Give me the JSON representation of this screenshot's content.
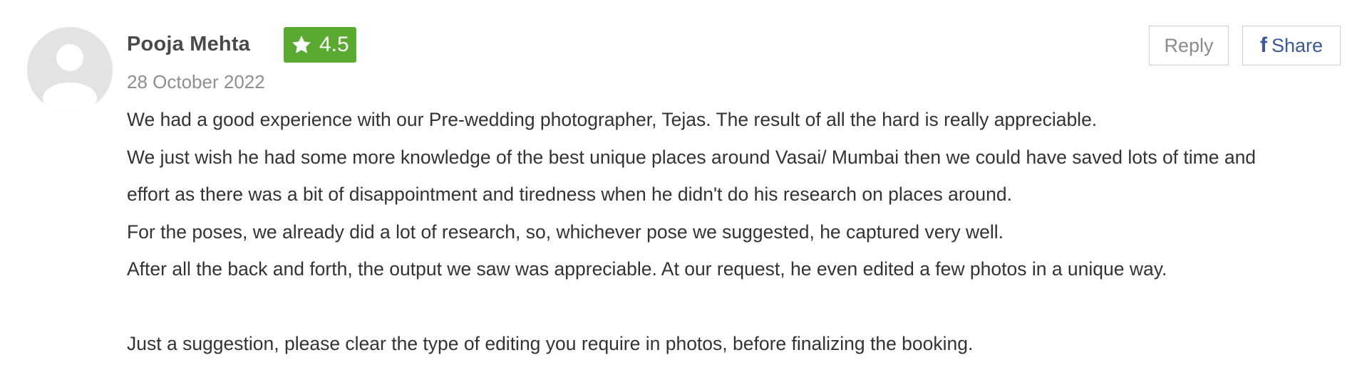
{
  "review": {
    "reviewer_name": "Pooja Mehta",
    "rating": "4.5",
    "date": "28 October 2022",
    "reply_label": "Reply",
    "share_icon": "f",
    "share_label": "Share",
    "paragraphs": [
      "We had a good experience with our Pre-wedding photographer, Tejas. The result of all the hard is really appreciable.",
      "We just wish he had some more knowledge of the best unique places around Vasai/ Mumbai then we could have saved lots of time and",
      "effort as there was a bit of disappointment and tiredness when he didn't do his research on places around.",
      "For the poses, we already did a lot of research, so, whichever pose we suggested, he captured very well.",
      "After all the back and forth, the output we saw was appreciable. At our request, he even edited a few photos in a unique way.",
      "",
      "Just a suggestion, please clear the type of editing you require in photos, before finalizing the booking."
    ]
  },
  "icons": {
    "avatar": "user-placeholder-icon",
    "rating": "star-icon",
    "share": "facebook-icon"
  },
  "colors": {
    "rating_badge": "#5aa931",
    "facebook_blue": "#3b5998",
    "date_gray": "#8f8f8f",
    "avatar_gray": "#e3e3e3"
  }
}
